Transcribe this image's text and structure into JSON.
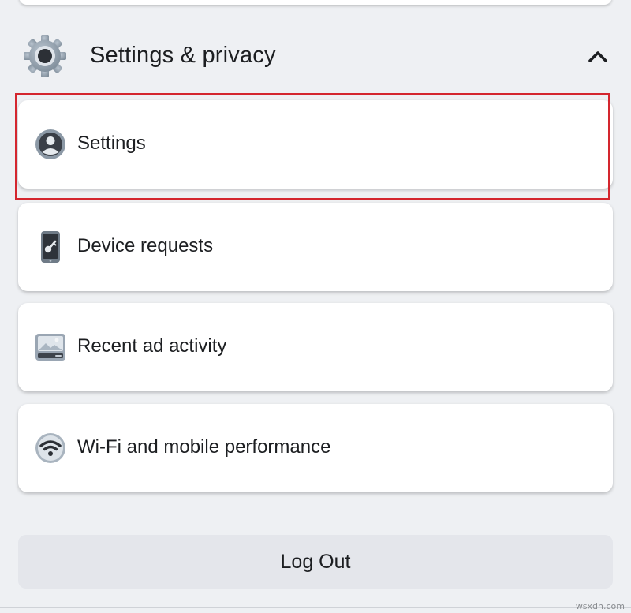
{
  "section": {
    "title": "Settings & privacy",
    "expanded": true
  },
  "menu_items": [
    {
      "label": "Settings",
      "icon": "profile-icon",
      "highlighted": true
    },
    {
      "label": "Device requests",
      "icon": "phone-key-icon",
      "highlighted": false
    },
    {
      "label": "Recent ad activity",
      "icon": "ad-image-icon",
      "highlighted": false
    },
    {
      "label": "Wi-Fi and mobile performance",
      "icon": "wifi-icon",
      "highlighted": false
    }
  ],
  "logout": {
    "label": "Log Out"
  },
  "watermark": "wsxdn.com",
  "colors": {
    "background": "#eef0f3",
    "card": "#ffffff",
    "highlight_border": "#d4262e",
    "logout_button": "#e4e6eb",
    "text": "#1c1e21"
  }
}
